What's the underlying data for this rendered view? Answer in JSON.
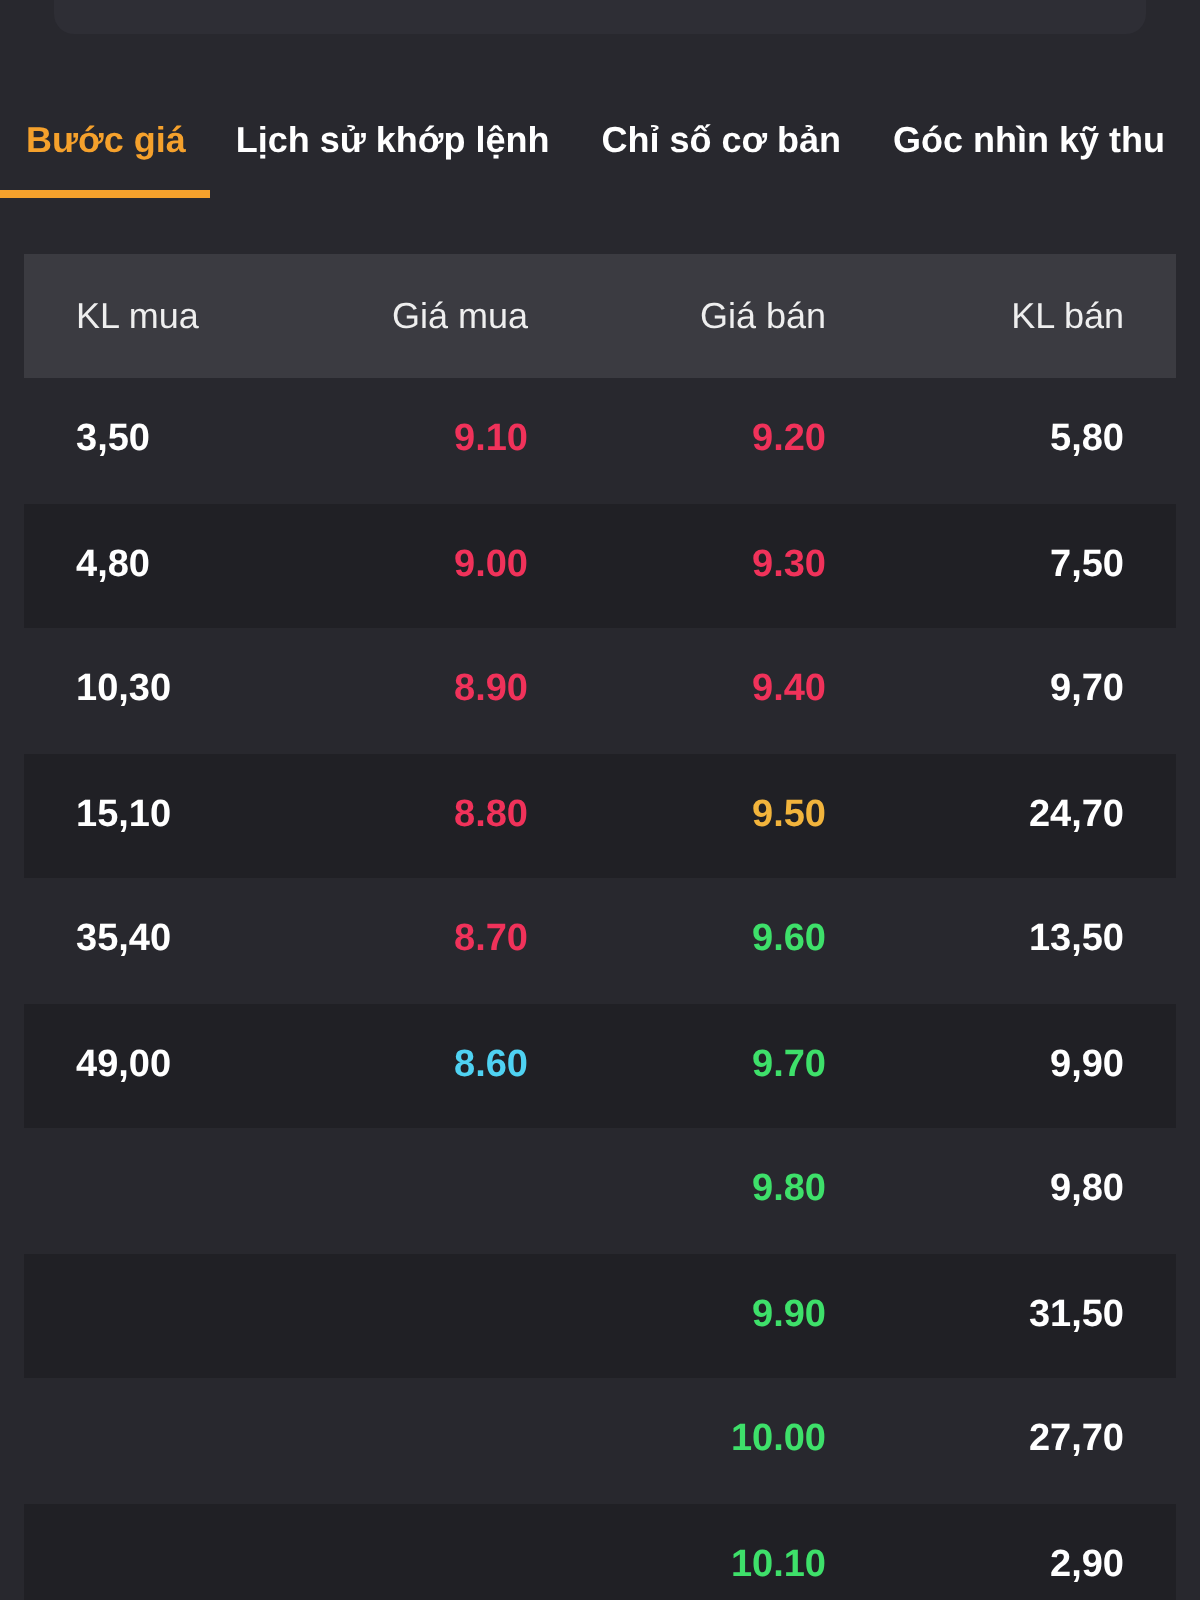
{
  "tabs": [
    {
      "label": "Bước giá",
      "selected": true
    },
    {
      "label": "Lịch sử khớp lệnh",
      "selected": false
    },
    {
      "label": "Chỉ số cơ bản",
      "selected": false
    },
    {
      "label": "Góc nhìn kỹ thu",
      "selected": false
    }
  ],
  "table": {
    "columns": [
      "KL mua",
      "Giá mua",
      "Giá bán",
      "KL bán"
    ],
    "rows": [
      {
        "buy_volume": "3,50",
        "buy_price": {
          "value": "9.10",
          "color": "#f0325a"
        },
        "sell_price": {
          "value": "9.20",
          "color": "#f0325a"
        },
        "sell_volume": "5,80"
      },
      {
        "buy_volume": "4,80",
        "buy_price": {
          "value": "9.00",
          "color": "#f0325a"
        },
        "sell_price": {
          "value": "9.30",
          "color": "#f0325a"
        },
        "sell_volume": "7,50"
      },
      {
        "buy_volume": "10,30",
        "buy_price": {
          "value": "8.90",
          "color": "#f0325a"
        },
        "sell_price": {
          "value": "9.40",
          "color": "#f0325a"
        },
        "sell_volume": "9,70"
      },
      {
        "buy_volume": "15,10",
        "buy_price": {
          "value": "8.80",
          "color": "#f0325a"
        },
        "sell_price": {
          "value": "9.50",
          "color": "#f2b43c"
        },
        "sell_volume": "24,70"
      },
      {
        "buy_volume": "35,40",
        "buy_price": {
          "value": "8.70",
          "color": "#f0325a"
        },
        "sell_price": {
          "value": "9.60",
          "color": "#3ee06a"
        },
        "sell_volume": "13,50"
      },
      {
        "buy_volume": "49,00",
        "buy_price": {
          "value": "8.60",
          "color": "#4fd2f2"
        },
        "sell_price": {
          "value": "9.70",
          "color": "#3ee06a"
        },
        "sell_volume": "9,90"
      },
      {
        "sell_price": {
          "value": "9.80",
          "color": "#3ee06a"
        },
        "sell_volume": "9,80"
      },
      {
        "sell_price": {
          "value": "9.90",
          "color": "#3ee06a"
        },
        "sell_volume": "31,50"
      },
      {
        "sell_price": {
          "value": "10.00",
          "color": "#3ee06a"
        },
        "sell_volume": "27,70"
      },
      {
        "sell_price": {
          "value": "10.10",
          "color": "#3ee06a"
        },
        "sell_volume": "2,90"
      }
    ]
  }
}
